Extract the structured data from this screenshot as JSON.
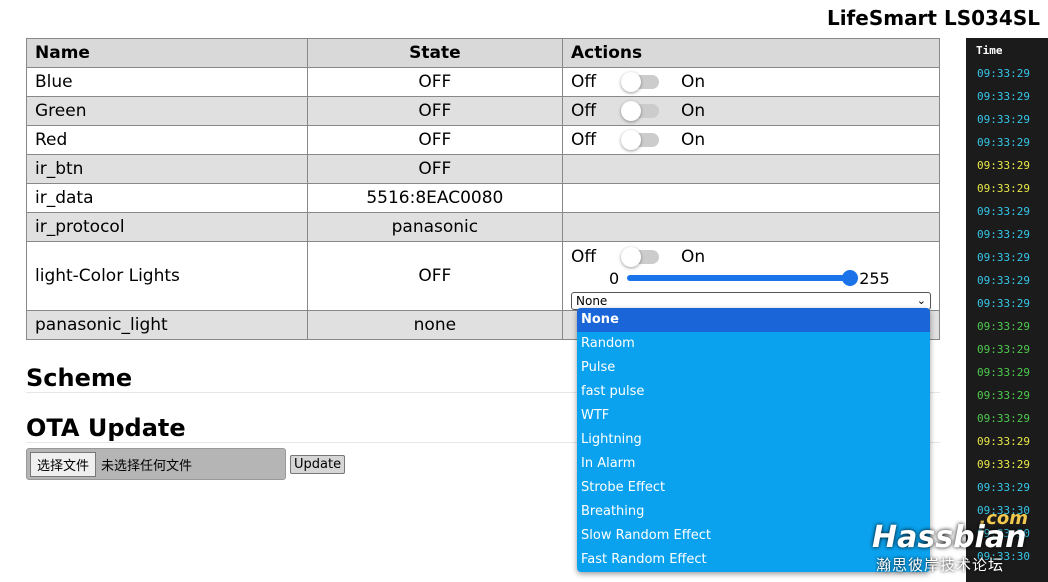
{
  "device_title": "LifeSmart LS034SL",
  "table": {
    "headers": {
      "name": "Name",
      "state": "State",
      "actions": "Actions"
    },
    "switch_labels": {
      "off": "Off",
      "on": "On"
    },
    "rows": [
      {
        "name": "Blue",
        "state": "OFF"
      },
      {
        "name": "Green",
        "state": "OFF"
      },
      {
        "name": "Red",
        "state": "OFF"
      },
      {
        "name": "ir_btn",
        "state": "OFF"
      },
      {
        "name": "ir_data",
        "state": "5516:8EAC0080"
      },
      {
        "name": "ir_protocol",
        "state": "panasonic"
      },
      {
        "name": "light-Color Lights",
        "state": "OFF"
      },
      {
        "name": "panasonic_light",
        "state": "none"
      }
    ],
    "slider": {
      "min_label": "0",
      "max_label": "255",
      "value_fraction": 1.0
    },
    "effect_select": {
      "selected": "None"
    }
  },
  "sections": {
    "scheme": "Scheme",
    "ota": "OTA Update"
  },
  "ota": {
    "choose_file": "选择文件",
    "no_file": "未选择任何文件",
    "update": "Update"
  },
  "dropdown_options": [
    "None",
    "Random",
    "Pulse",
    "fast pulse",
    "WTF",
    "Lightning",
    "In Alarm",
    "Strobe Effect",
    "Breathing",
    "Slow Random Effect",
    "Fast Random Effect"
  ],
  "log": {
    "header": "Time",
    "rows": [
      {
        "time": "09:33:29",
        "color": "#35c6e8"
      },
      {
        "time": "09:33:29",
        "color": "#35c6e8"
      },
      {
        "time": "09:33:29",
        "color": "#35c6e8"
      },
      {
        "time": "09:33:29",
        "color": "#35c6e8"
      },
      {
        "time": "09:33:29",
        "color": "#e8e84a"
      },
      {
        "time": "09:33:29",
        "color": "#e8e84a"
      },
      {
        "time": "09:33:29",
        "color": "#35c6e8"
      },
      {
        "time": "09:33:29",
        "color": "#35c6e8"
      },
      {
        "time": "09:33:29",
        "color": "#35c6e8"
      },
      {
        "time": "09:33:29",
        "color": "#35c6e8"
      },
      {
        "time": "09:33:29",
        "color": "#35c6e8"
      },
      {
        "time": "09:33:29",
        "color": "#4ec94e"
      },
      {
        "time": "09:33:29",
        "color": "#4ec94e"
      },
      {
        "time": "09:33:29",
        "color": "#4ec94e"
      },
      {
        "time": "09:33:29",
        "color": "#4ec94e"
      },
      {
        "time": "09:33:29",
        "color": "#4ec94e"
      },
      {
        "time": "09:33:29",
        "color": "#e8e84a"
      },
      {
        "time": "09:33:29",
        "color": "#e8e84a"
      },
      {
        "time": "09:33:29",
        "color": "#35c6e8"
      },
      {
        "time": "09:33:30",
        "color": "#35c6e8"
      },
      {
        "time": "09:33:30",
        "color": "#35c6e8"
      },
      {
        "time": "09:33:30",
        "color": "#35c6e8"
      }
    ]
  },
  "watermark": {
    "com": ".com",
    "brand": "Hassbian",
    "subtitle": "瀚思彼岸技术论坛"
  }
}
